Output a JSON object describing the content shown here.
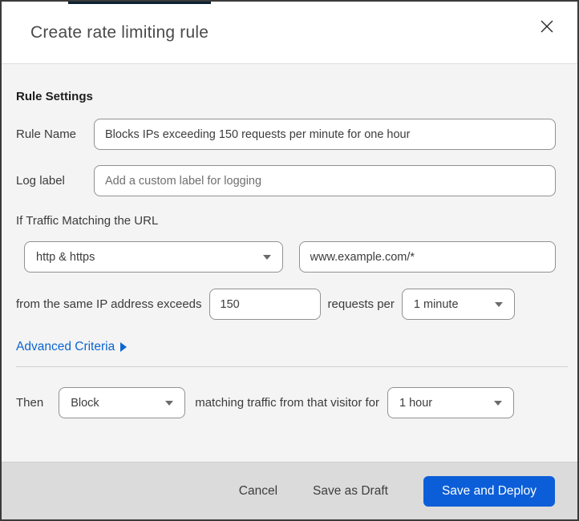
{
  "header": {
    "title": "Create rate limiting rule"
  },
  "form": {
    "section_title": "Rule Settings",
    "rule_name": {
      "label": "Rule Name",
      "value": "Blocks IPs exceeding 150 requests per minute for one hour"
    },
    "log_label": {
      "label": "Log label",
      "placeholder": "Add a custom label for logging"
    },
    "traffic_match": {
      "intro": "If Traffic Matching the URL",
      "scheme_selected": "http & https",
      "url_value": "www.example.com/*"
    },
    "threshold": {
      "prefix": "from the same IP address exceeds",
      "requests_value": "150",
      "middle": "requests per",
      "period_selected": "1 minute"
    },
    "advanced_criteria_label": "Advanced Criteria",
    "action": {
      "prefix": "Then",
      "action_selected": "Block",
      "middle": "matching traffic from that visitor for",
      "duration_selected": "1 hour"
    }
  },
  "footer": {
    "cancel_label": "Cancel",
    "save_draft_label": "Save as Draft",
    "save_deploy_label": "Save and Deploy"
  },
  "colors": {
    "primary_button": "#0b5ed7",
    "link": "#0b66d1",
    "top_strip": "#0c2133",
    "body_background": "#f4f4f4",
    "footer_background": "#dbdbdb"
  }
}
